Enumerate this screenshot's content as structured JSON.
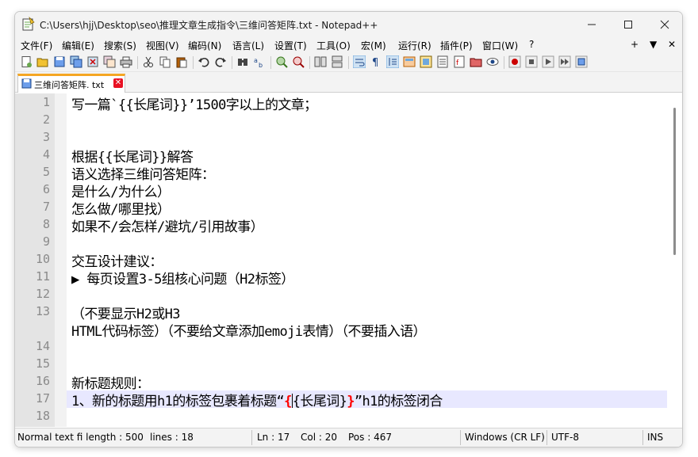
{
  "window": {
    "title": "C:\\Users\\hjj\\Desktop\\seo\\推理文章生成指令\\三维问答矩阵.txt - Notepad++",
    "minimize_icon": "minimize-icon",
    "maximize_icon": "maximize-icon",
    "close_icon": "close-icon"
  },
  "menu": {
    "items": [
      "文件(F)",
      "编辑(E)",
      "搜索(S)",
      "视图(V)",
      "编码(N)",
      "语言(L)",
      "设置(T)",
      "工具(O)",
      "宏(M)",
      "运行(R)",
      "插件(P)",
      "窗口(W)",
      "?"
    ],
    "right": [
      "+",
      "▼",
      "✕"
    ]
  },
  "tab": {
    "label": "三维问答矩阵. txt",
    "close_symbol": "✕"
  },
  "editor": {
    "line_numbers": [
      "1",
      "2",
      "3",
      "4",
      "5",
      "6",
      "7",
      "8",
      "9",
      "10",
      "11",
      "12",
      "13",
      "14",
      "15",
      "16",
      "17",
      "18"
    ],
    "lines": [
      "写一篇`{{长尾词}}’1500字以上的文章；",
      "",
      "",
      "根据{{长尾词}}解答",
      "语义选择三维问答矩阵：",
      "是什么/为什么）",
      "怎么做/哪里找）",
      "如果不/会怎样/避坑/引用故事）",
      "",
      "交互设计建议：",
      "▶ 每页设置3-5组核心问题（H2标签）",
      "",
      "（不要显示H2或H3",
      "HTML代码标签）（不要给文章添加emoji表情）（不要插入语）",
      "",
      "",
      "新标题规则：",
      "1、新的标题用h1的标签包裹着标题“",
      "{",
      "{长尾词}",
      "}",
      "”h1的标签闭合",
      ""
    ]
  },
  "status": {
    "type": "Normal text fi length : 500",
    "lines": "lines : 18",
    "ln": "Ln : 17",
    "col": "Col : 20",
    "pos": "Pos : 467",
    "eol": "Windows (CR LF)",
    "encoding": "UTF-8",
    "mode": "INS"
  },
  "colors": {
    "tab_accent": "#f5a623",
    "current_line": "#e8e8ff",
    "brace_match": "#ff0000",
    "close_hover": "#e81123"
  }
}
